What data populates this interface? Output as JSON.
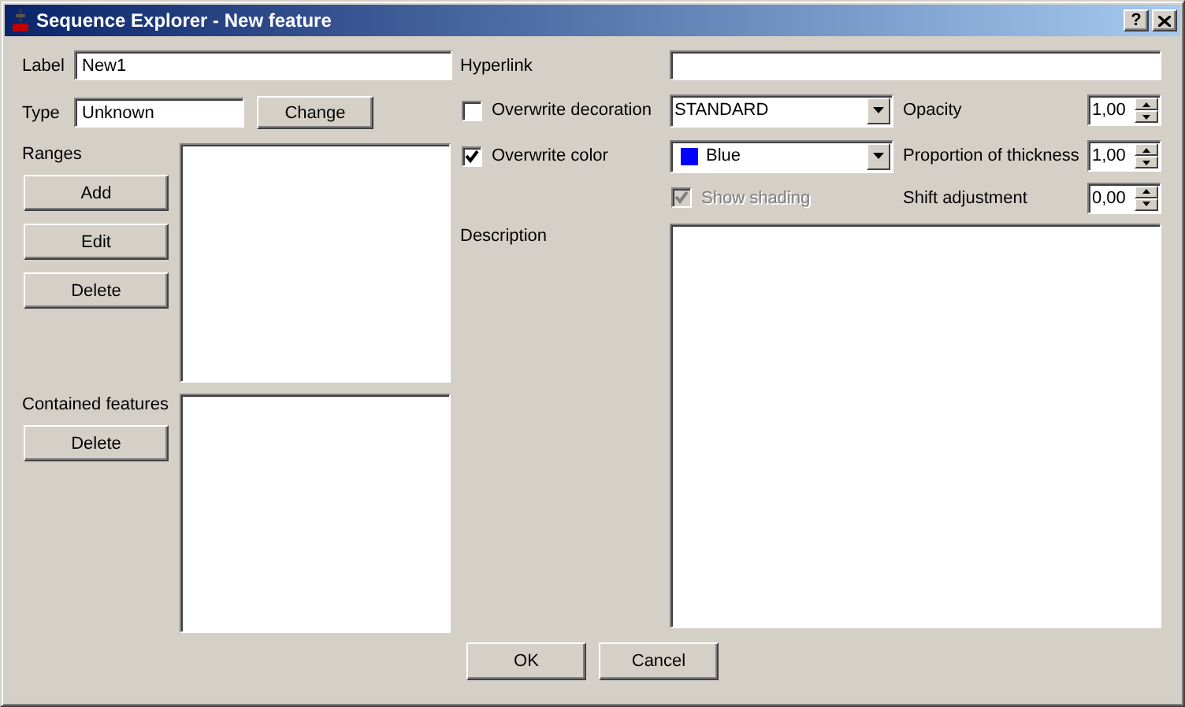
{
  "window": {
    "title": "Sequence Explorer - New feature",
    "help": "?"
  },
  "label_field": {
    "label": "Label",
    "value": "New1"
  },
  "type_field": {
    "label": "Type",
    "value": "Unknown",
    "button": "Change"
  },
  "ranges": {
    "label": "Ranges",
    "buttons": [
      "Add",
      "Edit",
      "Delete"
    ]
  },
  "contained_features": {
    "label": "Contained features",
    "buttons": [
      "Delete"
    ]
  },
  "hyperlink": {
    "label": "Hyperlink"
  },
  "options": [
    {
      "checkbox": {
        "label": "Overwrite decoration",
        "checked": false,
        "disabled": false
      },
      "combo": {
        "value": "STANDARD"
      },
      "spin": {
        "label": "Opacity",
        "value": "1,00"
      }
    },
    {
      "checkbox": {
        "label": "Overwrite color",
        "checked": true,
        "disabled": false
      },
      "combo": {
        "value": "Blue",
        "color": "#0000ff"
      },
      "spin": {
        "label": "Proportion of thickness",
        "value": "1,00"
      }
    },
    {
      "sub_checkbox": {
        "label": "Show shading",
        "checked": true,
        "disabled": true
      },
      "spin": {
        "label": "Shift adjustment",
        "value": "0,00"
      }
    }
  ],
  "description": {
    "label": "Description"
  },
  "footer_buttons": [
    "OK",
    "Cancel"
  ]
}
